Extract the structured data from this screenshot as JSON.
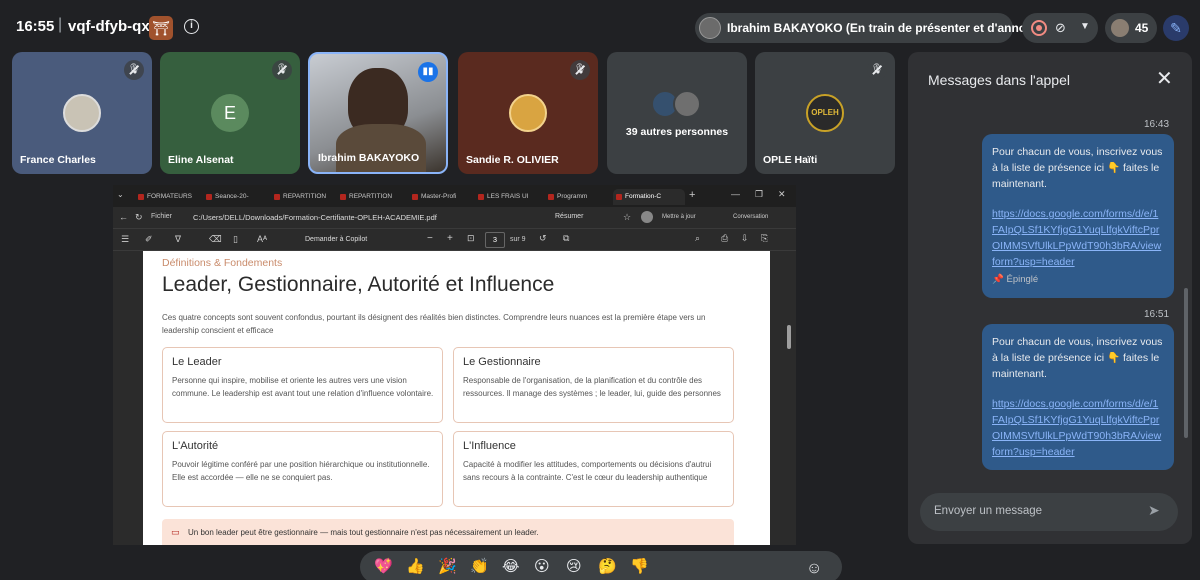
{
  "topbar": {
    "time": "16:55",
    "separator": "|",
    "meeting_code": "vqf-dfyb-qxj",
    "presenter_status": "Ibrahim BAKAYOKO (En train de présenter et d'annoter)",
    "participant_count": "45"
  },
  "participants": [
    {
      "name": "France Charles",
      "muted": true
    },
    {
      "name": "Eline Alsenat",
      "initial": "E",
      "muted": true
    },
    {
      "name": "Ibrahim BAKAYOKO",
      "speaking": true
    },
    {
      "name": "Sandie R. OLIVIER",
      "muted": true
    },
    {
      "label": "39 autres personnes"
    },
    {
      "name": "OPLE Haïti",
      "logo_text": "OPLEH",
      "muted": true
    }
  ],
  "browser": {
    "tabs": [
      "FORMATEURS",
      "Seance-20-",
      "REPARTITION",
      "REPARTITION",
      "Master-Profi",
      "LES FRAIS UI",
      "Programm",
      "Formation-C"
    ],
    "address_prefix": "Fichier",
    "address": "C:/Users/DELL/Downloads/Formation-Certifiante-OPLEH-ACADEMIE.pdf",
    "summarize_label": "Résumer",
    "update_label": "Mettre à jour",
    "conversation_label": "Conversation",
    "copilot_label": "Demander à Copilot",
    "page_current": "3",
    "page_total": "sur 9"
  },
  "document": {
    "kicker": "Définitions & Fondements",
    "title": "Leader, Gestionnaire, Autorité et Influence",
    "intro": "Ces quatre concepts sont souvent confondus, pourtant ils désignent des réalités bien distinctes. Comprendre leurs nuances est la première étape vers un leadership conscient et efficace",
    "cards": [
      {
        "title": "Le Leader",
        "body": "Personne qui inspire, mobilise et oriente les autres vers une vision commune. Le leadership est avant tout une relation d'influence volontaire."
      },
      {
        "title": "Le Gestionnaire",
        "body": "Responsable de l'organisation, de la planification et du contrôle des ressources. Il manage des systèmes ; le leader, lui, guide des personnes"
      },
      {
        "title": "L'Autorité",
        "body": "Pouvoir légitime conféré par une position hiérarchique ou institutionnelle. Elle est accordée — elle ne se conquiert pas."
      },
      {
        "title": "L'Influence",
        "body": "Capacité à modifier les attitudes, comportements ou décisions d'autrui sans recours à la contrainte. C'est le cœur du leadership authentique"
      }
    ],
    "note": "Un bon leader peut être gestionnaire — mais tout gestionnaire n'est pas nécessairement un leader."
  },
  "chat": {
    "title": "Messages dans l'appel",
    "messages": [
      {
        "time": "16:43",
        "text": "Pour chacun de vous, inscrivez vous à la liste de présence ici 👇 faites le maintenant.",
        "link": "https://docs.google.com/forms/d/e/1FAIpQLSf1KYfjgG1YuqLlfgkViftcPprOIMMSVfUlkLPpWdT90h3bRA/viewform?usp=header",
        "pinned": "Épinglé"
      },
      {
        "time": "16:51",
        "text": "Pour chacun de vous, inscrivez vous à la liste de présence ici 👇 faites le maintenant.",
        "link": "https://docs.google.com/forms/d/e/1FAIpQLSf1KYfjgG1YuqLlfgkViftcPprOIMMSVfUlkLPpWdT90h3bRA/viewform?usp=header"
      }
    ],
    "input_placeholder": "Envoyer un message"
  },
  "reactions": [
    "💖",
    "👍",
    "🎉",
    "👏",
    "😂",
    "😮",
    "😢",
    "🤔",
    "👎"
  ],
  "colors": {
    "background": "#202124",
    "chat_bubble": "#2f5a8a",
    "accent": "#8ab4f8"
  }
}
